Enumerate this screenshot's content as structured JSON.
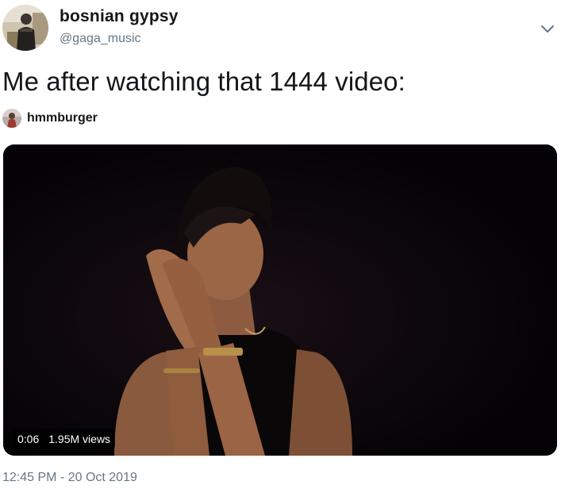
{
  "author": {
    "display_name": "bosnian gypsy",
    "handle": "@gaga_music"
  },
  "tweet": {
    "text": "Me after watching that 1444 video:",
    "media_credit": "hmmburger",
    "timestamp": "12:45 PM - 20 Oct 2019"
  },
  "video": {
    "duration": "0:06",
    "views": "1.95M views"
  },
  "icons": {
    "menu": "chevron-down-icon"
  },
  "colors": {
    "text": "#14171a",
    "secondary": "#657786",
    "video_bg": "#050306"
  }
}
